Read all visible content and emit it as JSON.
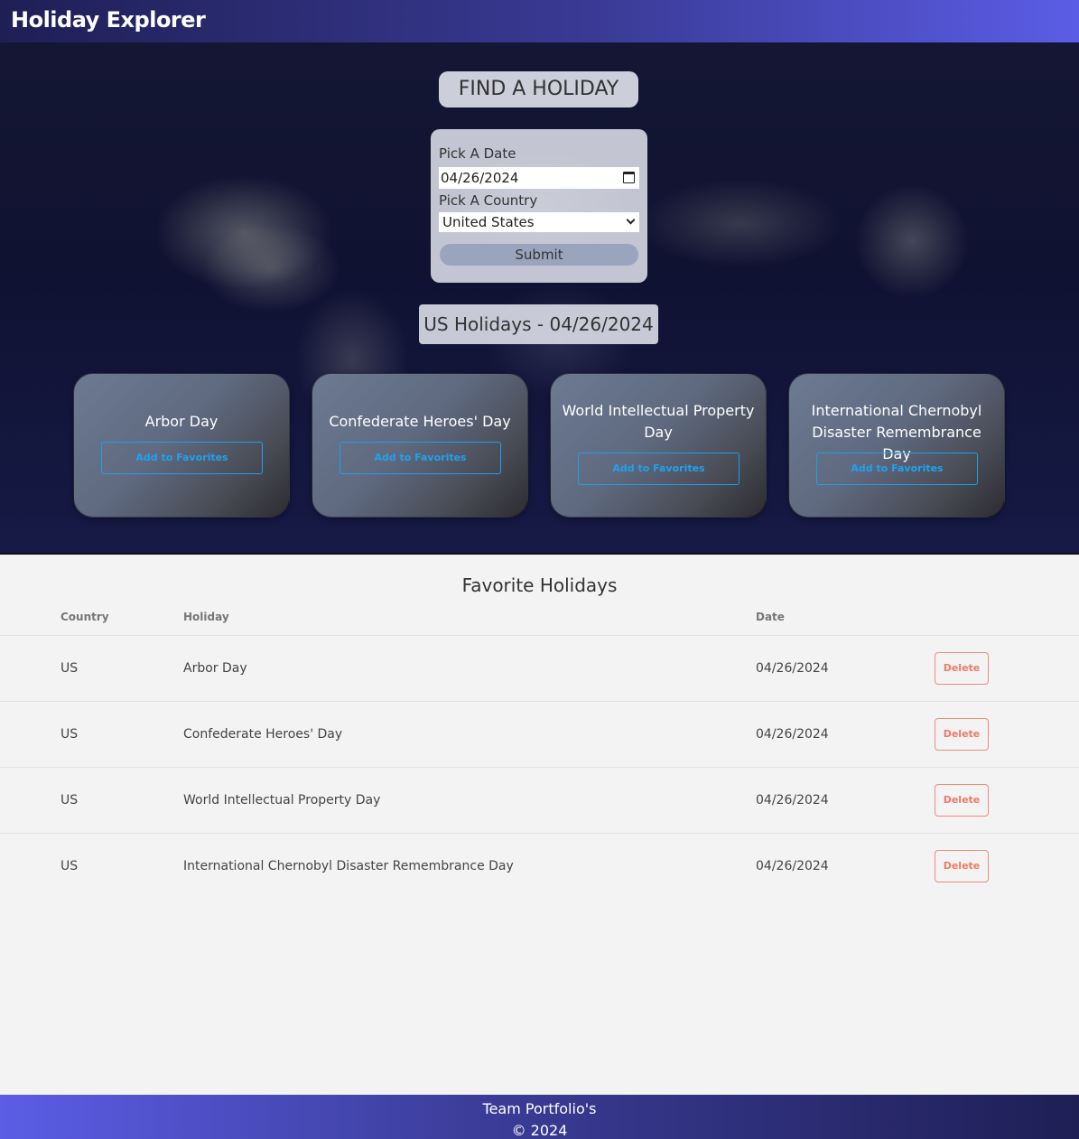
{
  "app": {
    "title": "Holiday Explorer"
  },
  "search": {
    "heading": "FIND A HOLIDAY",
    "date_label": "Pick A Date",
    "date_value": "04/26/2024",
    "country_label": "Pick A Country",
    "country_value": "United States",
    "submit_label": "Submit"
  },
  "results": {
    "heading": "US Holidays - 04/26/2024",
    "cards": [
      {
        "name": "Arbor Day",
        "button": "Add to Favorites"
      },
      {
        "name": "Confederate Heroes' Day",
        "button": "Add to Favorites"
      },
      {
        "name": "World Intellectual Property Day",
        "button": "Add to Favorites"
      },
      {
        "name": "International Chernobyl Disaster Remembrance Day",
        "button": "Add to Favorites"
      }
    ]
  },
  "favorites": {
    "heading": "Favorite Holidays",
    "columns": [
      "Country",
      "Holiday",
      "Date"
    ],
    "rows": [
      {
        "country": "US",
        "holiday": "Arbor Day",
        "date": "04/26/2024",
        "action": "Delete"
      },
      {
        "country": "US",
        "holiday": "Confederate Heroes' Day",
        "date": "04/26/2024",
        "action": "Delete"
      },
      {
        "country": "US",
        "holiday": "World Intellectual Property Day",
        "date": "04/26/2024",
        "action": "Delete"
      },
      {
        "country": "US",
        "holiday": "International Chernobyl Disaster Remembrance Day",
        "date": "04/26/2024",
        "action": "Delete"
      }
    ]
  },
  "footer": {
    "line1": "Team Portfolio's",
    "line2": "© 2024"
  },
  "colors": {
    "accent_blue": "#1ea2ef",
    "delete_red": "#f07a68",
    "header_start": "#1e1f55",
    "header_end": "#5b5de6"
  }
}
